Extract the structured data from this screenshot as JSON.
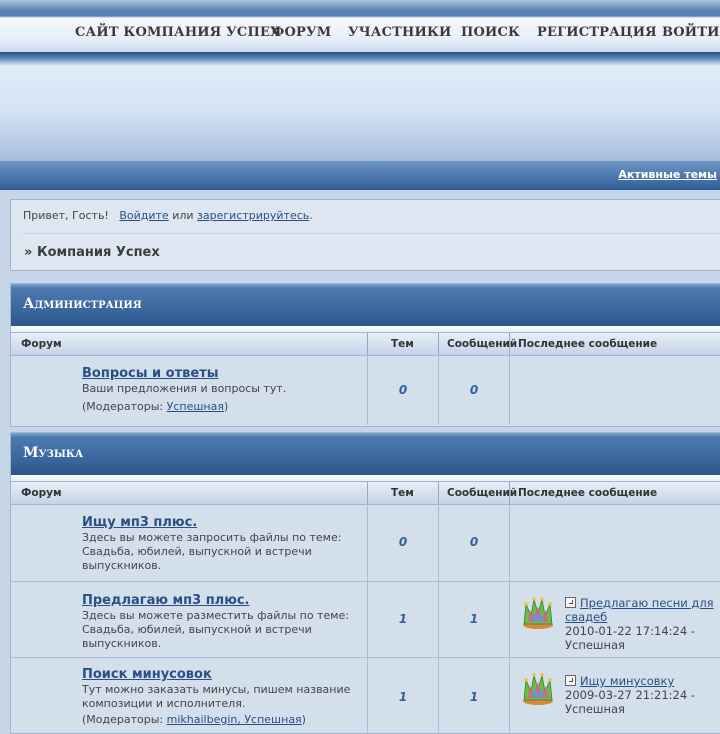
{
  "nav": {
    "items": [
      "САЙТ КОМПАНИЯ УСПЕХ",
      "ФОРУМ",
      "УЧАСТНИКИ",
      "ПОИСК",
      "РЕГИСТРАЦИЯ",
      "ВОЙТИ"
    ]
  },
  "subnav": {
    "active_topics": "Активные темы"
  },
  "greeting": {
    "prefix": "Привет, Гость!",
    "login": "Войдите",
    "or": "или",
    "register": "зарегистрируйтесь",
    "period": "."
  },
  "breadcrumb": {
    "marker": "»",
    "label": "Компания Успех"
  },
  "columns": {
    "forum": "Форум",
    "topics": "Тем",
    "posts": "Сообщений",
    "last": "Последнее сообщение"
  },
  "categories": [
    {
      "title": "Администрация",
      "forums": [
        {
          "name": "Вопросы и ответы",
          "desc": "Ваши предложения и вопросы тут.",
          "moderators_prefix": "(Модераторы:",
          "moderator": "Успешная",
          "moderators_suffix": ")",
          "topics": "0",
          "posts": "0"
        }
      ]
    },
    {
      "title": "Музыка",
      "forums": [
        {
          "name": "Ищу мп3 плюс.",
          "desc": "Здесь вы можете запросить файлы по теме: Свадьба, юбилей, выпускной и встречи выпускников.",
          "topics": "0",
          "posts": "0"
        },
        {
          "name": "Предлагаю мп3 плюс.",
          "desc": "Здесь вы можете разместить файлы по теме: Свадьба, юбилей, выпускной и встречи выпускников.",
          "topics": "1",
          "posts": "1",
          "last_title": "Предлагаю песни для свадеб",
          "last_date": "2010-01-22 17:14:24 -",
          "last_author": "Успешная"
        },
        {
          "name": "Поиск минусовок",
          "desc": "Тут можно заказать минусы, пишем название композиции и исполнителя.",
          "moderators_prefix": "(Модераторы:",
          "moderator": "mikhailbegin, Успешная",
          "moderators_suffix": ")",
          "topics": "1",
          "posts": "1",
          "last_title": "Ищу минусовку",
          "last_date": "2009-03-27 21:21:24 -",
          "last_author": "Успешная"
        }
      ]
    }
  ]
}
